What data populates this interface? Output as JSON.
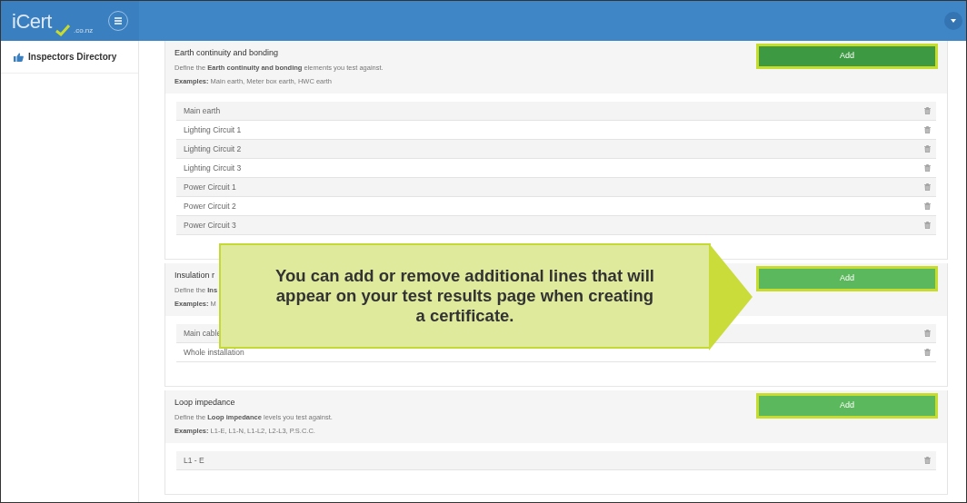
{
  "brand": {
    "name": "iCert",
    "suffix": ".co.nz"
  },
  "sidebar": {
    "items": [
      {
        "label": "Inspectors Directory",
        "selected": false
      }
    ]
  },
  "sections": [
    {
      "title": "Earth continuity and bonding",
      "description": "Define the **Earth continuity and bonding** elements you test against.",
      "examples": "**Examples:** Main earth, Meter box earth, HWC earth",
      "button": {
        "label": "Add",
        "highlighted": true,
        "pressed": true
      },
      "items": [
        "Main earth",
        "Lighting Circuit 1",
        "Lighting Circuit 2",
        "Lighting Circuit 3",
        "Power Circuit 1",
        "Power Circuit 2",
        "Power Circuit 3"
      ]
    },
    {
      "title": "Insulation r",
      "description": "Define the **Ins**",
      "examples": "**Examples:** M",
      "button": {
        "label": "Add",
        "highlighted": true,
        "pressed": false
      },
      "items": [
        "Main cable",
        "Whole installation"
      ]
    },
    {
      "title": "Loop impedance",
      "description": "Define the **Loop impedance** levels you test against.",
      "examples": "**Examples:** L1-E, L1-N, L1-L2, L2-L3, P.S.C.C.",
      "button": {
        "label": "Add",
        "highlighted": true,
        "pressed": false
      },
      "items": [
        "L1 - E"
      ]
    }
  ],
  "callout": {
    "text": "You can add or remove additional lines that will appear on your test results page when creating a certificate."
  }
}
